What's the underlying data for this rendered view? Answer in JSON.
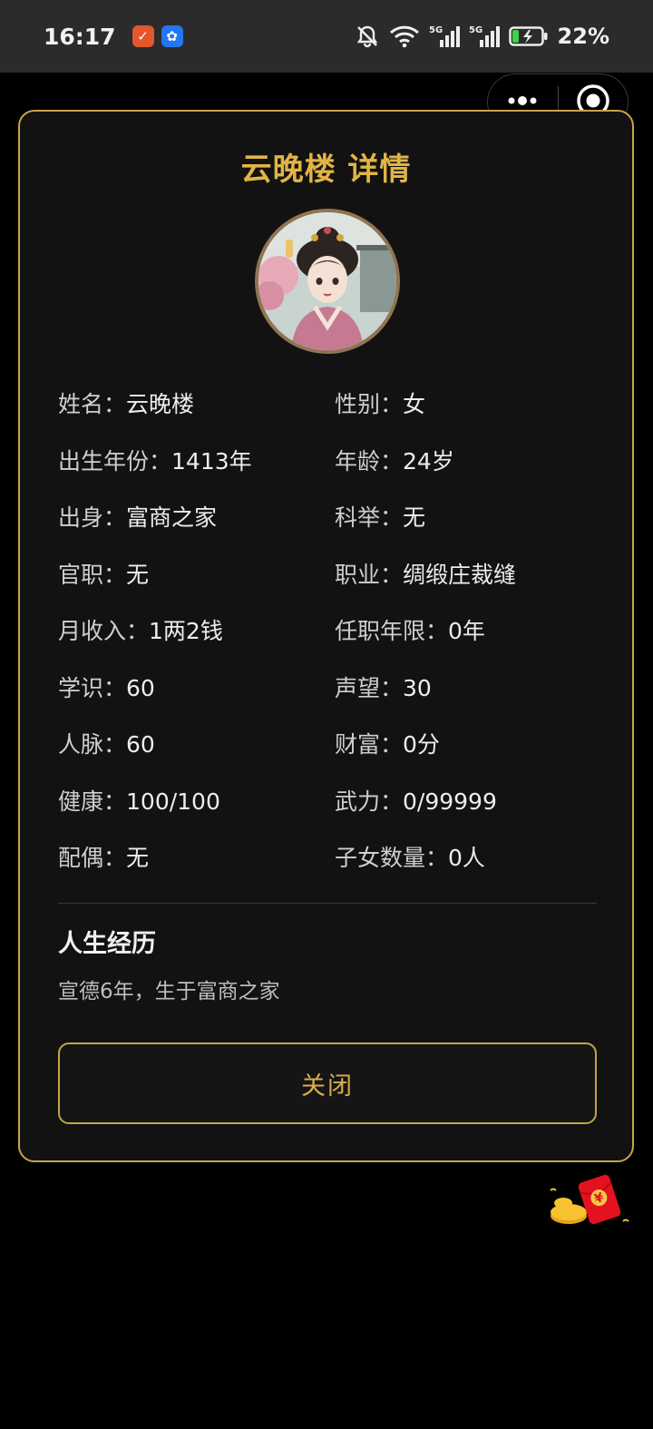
{
  "status_bar": {
    "time": "16:17",
    "battery": "22%",
    "network_1": "5G",
    "network_2": "5G"
  },
  "capsule": {
    "more_icon": "more-dots-icon",
    "close_icon": "target-circle-icon"
  },
  "modal": {
    "title": "云晚楼 详情",
    "avatar_icon": "portrait-avatar",
    "fields": [
      {
        "label": "姓名：",
        "value": "云晚楼"
      },
      {
        "label": "性别：",
        "value": "女"
      },
      {
        "label": "出生年份：",
        "value": "1413年"
      },
      {
        "label": "年龄：",
        "value": "24岁"
      },
      {
        "label": "出身：",
        "value": "富商之家"
      },
      {
        "label": "科举：",
        "value": "无"
      },
      {
        "label": "官职：",
        "value": "无"
      },
      {
        "label": "职业：",
        "value": "绸缎庄裁缝"
      },
      {
        "label": "月收入：",
        "value": "1两2钱"
      },
      {
        "label": "任职年限：",
        "value": "0年"
      },
      {
        "label": "学识：",
        "value": "60"
      },
      {
        "label": "声望：",
        "value": "30"
      },
      {
        "label": "人脉：",
        "value": "60"
      },
      {
        "label": "财富：",
        "value": "0分"
      },
      {
        "label": "健康：",
        "value": "100/100"
      },
      {
        "label": "武力：",
        "value": "0/99999"
      },
      {
        "label": "配偶：",
        "value": "无"
      },
      {
        "label": "子女数量：",
        "value": "0人"
      }
    ],
    "history_title": "人生经历",
    "history": [
      "宣德6年，生于富商之家"
    ],
    "close_label": "关闭"
  },
  "floating": {
    "red_packet_icon": "red-packet-icon",
    "red_packet_symbol": "¥"
  },
  "colors": {
    "accent_gold": "#c9a347",
    "title_gold": "#e2b445",
    "card_bg": "#121212",
    "page_bg": "#000000"
  }
}
